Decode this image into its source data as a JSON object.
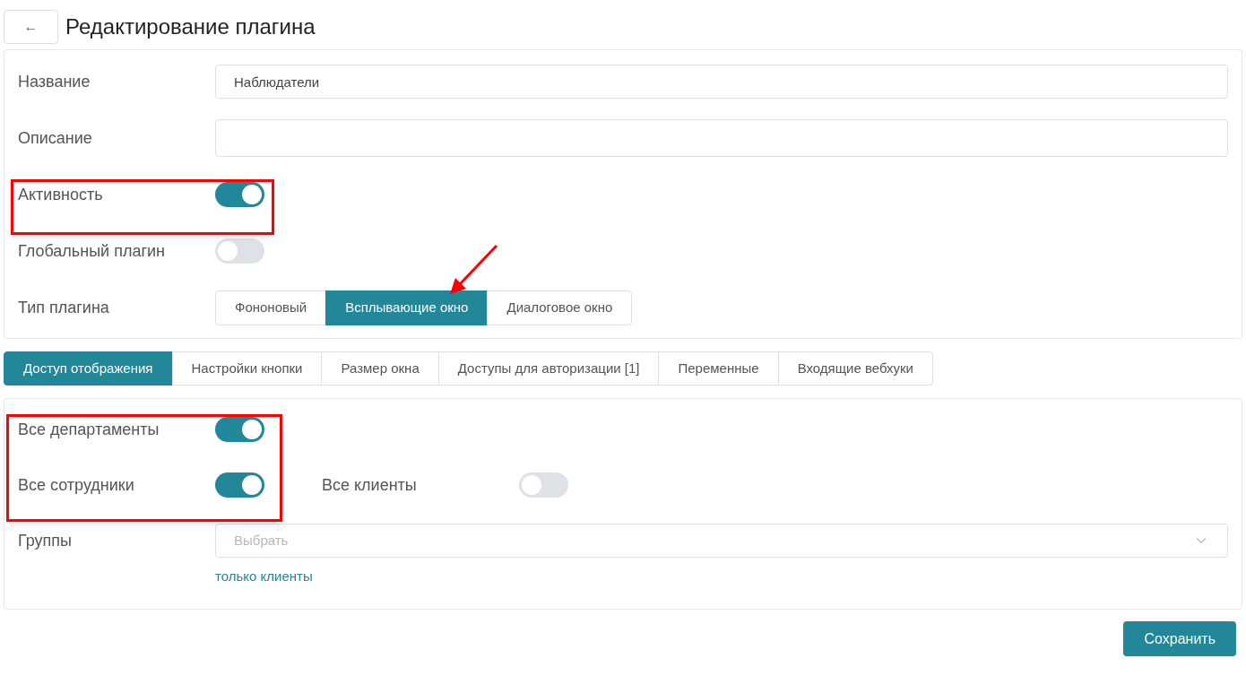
{
  "header": {
    "back_icon": "←",
    "title": "Редактирование плагина"
  },
  "main_form": {
    "name_field": {
      "label": "Название",
      "value": "Наблюдатели"
    },
    "description_field": {
      "label": "Описание"
    },
    "toggles": [
      {
        "label": "Активность",
        "on": true
      },
      {
        "label": "Глобальный плагин",
        "on": false
      }
    ],
    "plugin_type": {
      "label": "Тип плагина",
      "options": [
        {
          "label": "Фононовый",
          "selected": false
        },
        {
          "label": "Всплывающие окно",
          "selected": true
        },
        {
          "label": "Диалоговое окно",
          "selected": false
        }
      ]
    }
  },
  "tabs": [
    {
      "label": "Доступ отображения",
      "selected": true
    },
    {
      "label": "Настройки кнопки",
      "selected": false
    },
    {
      "label": "Размер окна",
      "selected": false
    },
    {
      "label": "Доступы для авторизации [1]",
      "selected": false
    },
    {
      "label": "Переменные",
      "selected": false
    },
    {
      "label": "Входящие вебхуки",
      "selected": false
    }
  ],
  "access": {
    "all_departments": {
      "label": "Все департаменты",
      "on": true
    },
    "all_employees": {
      "label": "Все сотрудники",
      "on": true
    },
    "all_clients": {
      "label": "Все клиенты",
      "on": false
    },
    "groups": {
      "label": "Группы",
      "placeholder": "Выбрать",
      "hint": "только клиенты"
    }
  },
  "save_button": "Сохранить"
}
